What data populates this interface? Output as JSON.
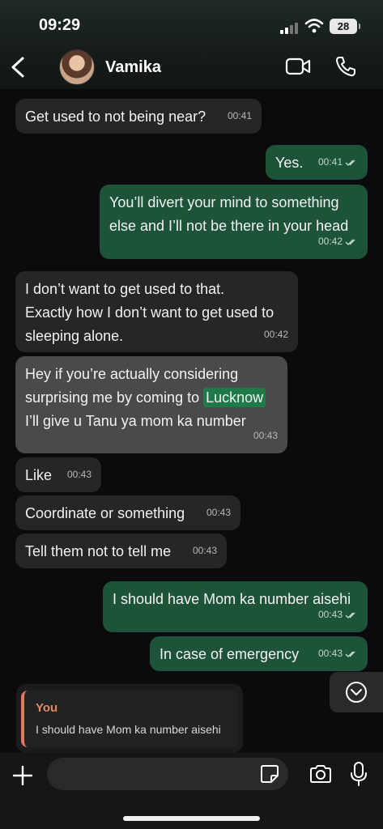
{
  "status_bar": {
    "time": "09:29",
    "battery": "28"
  },
  "header": {
    "contact_name": "Vamika"
  },
  "messages": [
    {
      "text": "Get used to not being near?",
      "time": "00:41"
    },
    {
      "text": "Yes.",
      "time": "00:41"
    },
    {
      "text": "You’ll divert your mind to something\nelse and I’ll not be there in your head",
      "time": "00:42"
    },
    {
      "text": "I don’t want to get used to that.\nExactly how I don’t want to get used to\nsleeping alone.",
      "time": "00:42"
    },
    {
      "text_before": "Hey if you’re actually considering\nsurprising me by coming to ",
      "highlight": "Lucknow",
      "text_after": "\nI’ll give u Tanu ya mom ka number",
      "time": "00:43"
    },
    {
      "text": "Like",
      "time": "00:43"
    },
    {
      "text": "Coordinate or something",
      "time": "00:43"
    },
    {
      "text": "Tell them not to tell me",
      "time": "00:43"
    },
    {
      "text": "I should have Mom ka number aisehi",
      "time": "00:43"
    },
    {
      "text": "In case of emergency",
      "time": "00:43"
    }
  ],
  "reply_preview": {
    "author": "You",
    "text": "I should have Mom ka number aisehi"
  },
  "input": {
    "value": ""
  }
}
